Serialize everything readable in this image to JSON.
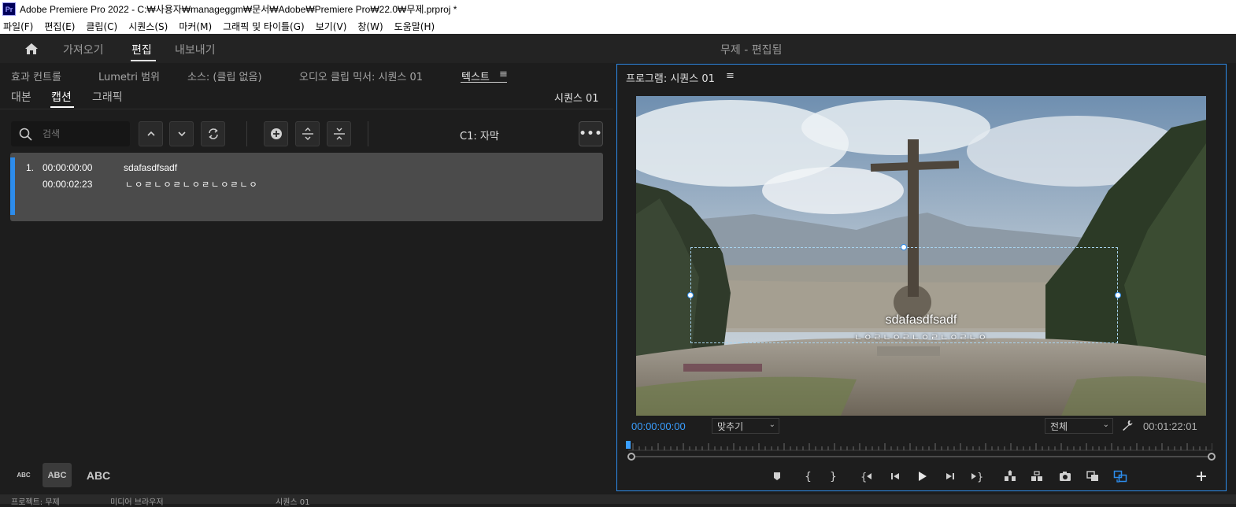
{
  "app": {
    "logo_text": "Pr",
    "window_title": "Adobe Premiere Pro 2022 - C:₩사용자₩manageggm₩문서₩Adobe₩Premiere Pro₩22.0₩무제.prproj *"
  },
  "menubar": [
    "파일(F)",
    "편집(E)",
    "클립(C)",
    "시퀀스(S)",
    "마커(M)",
    "그래픽 및 타이틀(G)",
    "보기(V)",
    "창(W)",
    "도움말(H)"
  ],
  "workspace": {
    "tabs": [
      "가져오기",
      "편집",
      "내보내기"
    ],
    "active_tab": "편집",
    "project_title": "무제 - 편집됨"
  },
  "left_panel": {
    "tabs": [
      "효과 컨트롤",
      "Lumetri 범위",
      "소스: (클립 없음)",
      "오디오 클립 믹서: 시퀀스 01",
      "텍스트"
    ],
    "active_tab": "텍스트",
    "subtabs": [
      "대본",
      "캡션",
      "그래픽"
    ],
    "active_subtab": "캡션",
    "sequence_name": "시퀀스 01",
    "search_placeholder": "검색",
    "track_label": "C1: 자막",
    "more_label": "•••",
    "captions": [
      {
        "index": "1.",
        "in_time": "00:00:00:00",
        "out_time": "00:00:02:23",
        "line1": "sdafasdfsadf",
        "line2": "ㄴㅇㄹㄴㅇㄹㄴㅇㄹㄴㅇㄹㄴㅇ"
      }
    ],
    "text_sizes": [
      "ABC",
      "ABC",
      "ABC"
    ]
  },
  "bottom_strip": {
    "items": [
      "프로젝트: 무제",
      "미디어 브라우저",
      "시퀀스 01"
    ]
  },
  "program_monitor": {
    "title": "프로그램: 시퀀스 01",
    "subtitle_line1": "sdafasdfsadf",
    "subtitle_line2": "ㄴㅇㄹㄴㅇㄹㄴㅇㄹㄴㅇㄹㄴㅇ",
    "current_timecode": "00:00:00:00",
    "fit_option": "맞추기",
    "resolution_option": "전체",
    "duration_timecode": "00:01:22:01"
  },
  "colors": {
    "accent_blue": "#2d8ceb",
    "timecode_blue": "#3a9fff",
    "panel_bg": "#1d1d1d",
    "caption_row_bg": "#4b4b4b"
  },
  "icons": {
    "home": "home-icon",
    "search": "search-icon",
    "wrench": "wrench-icon",
    "transport": [
      "marker-icon",
      "mark-in-icon",
      "mark-out-icon",
      "go-to-in-icon",
      "step-back-icon",
      "play-icon",
      "step-forward-icon",
      "go-to-out-icon",
      "lift-icon",
      "extract-icon",
      "export-frame-icon",
      "comparison-view-icon",
      "proxy-toggle-icon",
      "add-button-icon"
    ]
  }
}
